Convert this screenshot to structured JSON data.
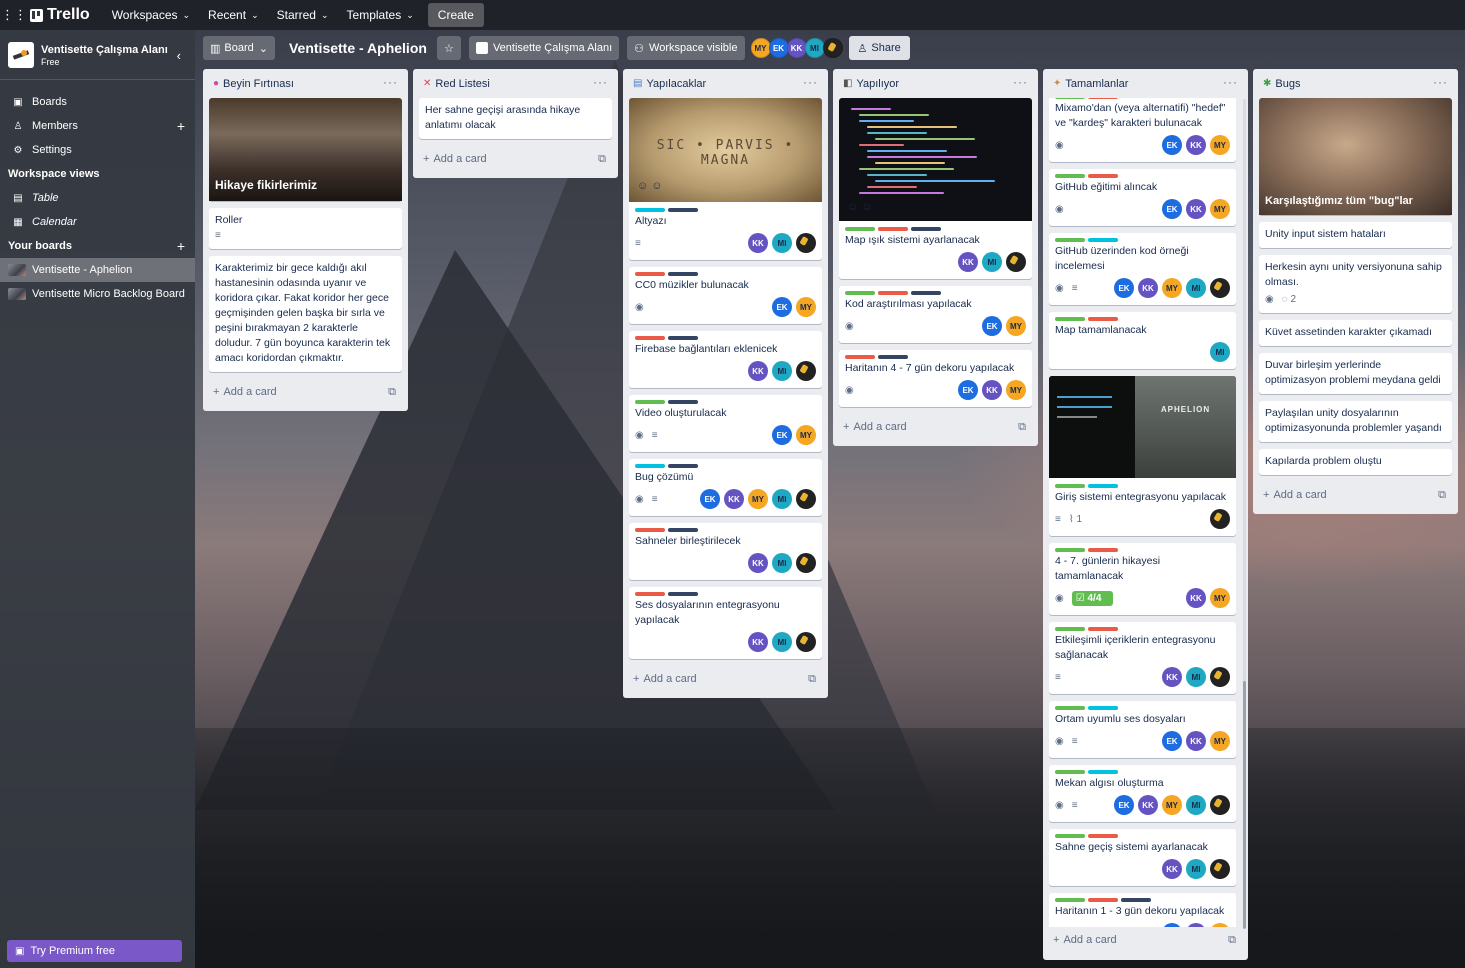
{
  "topbar": {
    "brand": "Trello",
    "nav": [
      "Workspaces",
      "Recent",
      "Starred",
      "Templates"
    ],
    "create_label": "Create"
  },
  "sidebar": {
    "workspace_name": "Ventisette Çalışma Alanı",
    "workspace_plan": "Free",
    "items": [
      {
        "label": "Boards",
        "icon": "board-icon"
      },
      {
        "label": "Members",
        "icon": "person-icon"
      },
      {
        "label": "Settings",
        "icon": "gear-icon"
      }
    ],
    "views_heading": "Workspace views",
    "views": [
      {
        "label": "Table",
        "icon": "table-icon"
      },
      {
        "label": "Calendar",
        "icon": "calendar-icon"
      }
    ],
    "boards_heading": "Your boards",
    "boards": [
      "Ventisette - Aphelion",
      "Ventisette Micro Backlog Board"
    ],
    "premium_label": "Try Premium free"
  },
  "boardbar": {
    "view_label": "Board",
    "title": "Ventisette - Aphelion",
    "workspace_label": "Ventisette Çalışma Alanı",
    "visibility_label": "Workspace visible",
    "share_label": "Share",
    "members": [
      "MY",
      "EK",
      "KK",
      "MI"
    ]
  },
  "add_card_label": "Add a card",
  "lists": [
    {
      "title": "Beyin Fırtınası",
      "emoji": "brain-icon",
      "cover_title": "Hikaye fikirlerimiz",
      "cards": [
        {
          "title": "Roller"
        },
        {
          "title": "Karakterimiz bir gece kaldığı akıl hastanesinin odasında uyanır ve koridora çıkar. Fakat koridor her gece geçmişinden gelen başka bir sırla ve peşini bırakmayan 2 karakterle doludur. 7 gün boyunca karakterin tek amacı koridordan çıkmaktır."
        }
      ]
    },
    {
      "title": "Red Listesi",
      "emoji": "cross-icon",
      "cards": [
        {
          "title": "Her sahne geçişi arasında hikaye anlatımı olacak"
        }
      ]
    },
    {
      "title": "Yapılacaklar",
      "emoji": "notepad-icon",
      "cover_text": "SIC • PARVIS • MAGNA",
      "cards": [
        {
          "title": "Altyazı",
          "members": [
            "KK",
            "MI",
            "pic"
          ]
        },
        {
          "title": "CC0 müzikler bulunacak",
          "members": [
            "EK",
            "MY"
          ]
        },
        {
          "title": "Firebase bağlantıları eklenicek",
          "members": [
            "KK",
            "MI",
            "pic"
          ]
        },
        {
          "title": "Video oluşturulacak",
          "members": [
            "EK",
            "MY"
          ]
        },
        {
          "title": "Bug çözümü",
          "members": [
            "EK",
            "KK",
            "MY",
            "MI",
            "pic"
          ]
        },
        {
          "title": "Sahneler birleştirilecek",
          "members": [
            "KK",
            "MI",
            "pic"
          ]
        },
        {
          "title": "Ses dosyalarının entegrasyonu yapılacak",
          "members": [
            "KK",
            "MI",
            "pic"
          ]
        }
      ]
    },
    {
      "title": "Yapılıyor",
      "emoji": "gamepad-icon",
      "cards": [
        {
          "title": "Map ışık sistemi ayarlanacak",
          "members": [
            "KK",
            "MI",
            "pic"
          ]
        },
        {
          "title": "Kod araştırılması yapılacak",
          "members": [
            "EK",
            "MY"
          ]
        },
        {
          "title": "Haritanın 4 - 7 gün dekoru yapılacak",
          "members": [
            "EK",
            "KK",
            "MY"
          ]
        }
      ]
    },
    {
      "title": "Tamamlanlar",
      "emoji": "party-icon",
      "cover_text": "APHELION",
      "checklist": "4/4",
      "attachments": "1",
      "cards": [
        {
          "title": "Mixamo'dan (veya alternatifi) \"hedef\" ve \"kardeş\" karakteri bulunacak",
          "members": [
            "EK",
            "KK",
            "MY"
          ]
        },
        {
          "title": "GitHub eğitimi alıncak",
          "members": [
            "EK",
            "KK",
            "MY"
          ]
        },
        {
          "title": "GitHub üzerinden kod örneği incelemesi",
          "members": [
            "EK",
            "KK",
            "MY",
            "MI",
            "pic"
          ]
        },
        {
          "title": "Map tamamlanacak",
          "members": [
            "MI"
          ]
        },
        {
          "title": "Giriş sistemi entegrasyonu yapılacak",
          "members": [
            "pic"
          ]
        },
        {
          "title": "4 - 7. günlerin hikayesi tamamlanacak",
          "members": [
            "KK",
            "MY"
          ]
        },
        {
          "title": "Etkileşimli içeriklerin entegrasyonu sağlanacak",
          "members": [
            "KK",
            "MI",
            "pic"
          ]
        },
        {
          "title": "Ortam uyumlu ses dosyaları",
          "members": [
            "EK",
            "KK",
            "MY"
          ]
        },
        {
          "title": "Mekan algısı oluşturma",
          "members": [
            "EK",
            "KK",
            "MY",
            "MI",
            "pic"
          ]
        },
        {
          "title": "Sahne geçiş sistemi ayarlanacak",
          "members": [
            "KK",
            "MI",
            "pic"
          ]
        },
        {
          "title": "Haritanın 1 - 3 gün dekoru yapılacak",
          "members": [
            "EK",
            "KK",
            "MY"
          ]
        }
      ]
    },
    {
      "title": "Bugs",
      "emoji": "bug-icon",
      "cover_title": "Karşılaştığımız tüm \"bug\"lar",
      "comments": "2",
      "cards": [
        {
          "title": "Unity input sistem hataları"
        },
        {
          "title": "Herkesin aynı unity versiyonuna sahip olması."
        },
        {
          "title": "Küvet assetinden karakter çıkamadı"
        },
        {
          "title": "Duvar birleşim yerlerinde optimizasyon problemi meydana geldi"
        },
        {
          "title": "Paylaşılan unity dosyalarının optimizasyonunda problemler yaşandı"
        },
        {
          "title": "Kapılarda problem oluştu"
        }
      ]
    }
  ]
}
